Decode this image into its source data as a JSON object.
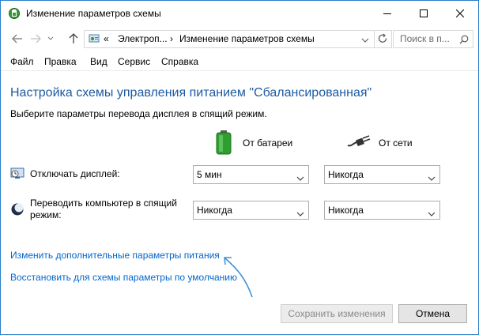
{
  "window": {
    "title": "Изменение параметров схемы"
  },
  "address": {
    "crumb1": "Электроп...",
    "crumb2": "Изменение параметров схемы"
  },
  "search": {
    "placeholder": "Поиск в п..."
  },
  "menu": [
    "Файл",
    "Правка",
    "Вид",
    "Сервис",
    "Справка"
  ],
  "main": {
    "heading": "Настройка схемы управления питанием \"Сбалансированная\"",
    "subtitle": "Выберите параметры перевода дисплея в спящий режим.",
    "col_battery": "От батареи",
    "col_ac": "От сети"
  },
  "rows": [
    {
      "label": "Отключать дисплей:",
      "battery": "5 мин",
      "ac": "Никогда"
    },
    {
      "label": "Переводить компьютер в спящий режим:",
      "battery": "Никогда",
      "ac": "Никогда"
    }
  ],
  "links": {
    "advanced": "Изменить дополнительные параметры питания",
    "restore": "Восстановить для схемы параметры по умолчанию"
  },
  "buttons": {
    "save": "Сохранить изменения",
    "cancel": "Отмена"
  },
  "colors": {
    "heading": "#1e5aa0",
    "link": "#0066cc",
    "annotation_arrow": "#3c8fd6"
  }
}
